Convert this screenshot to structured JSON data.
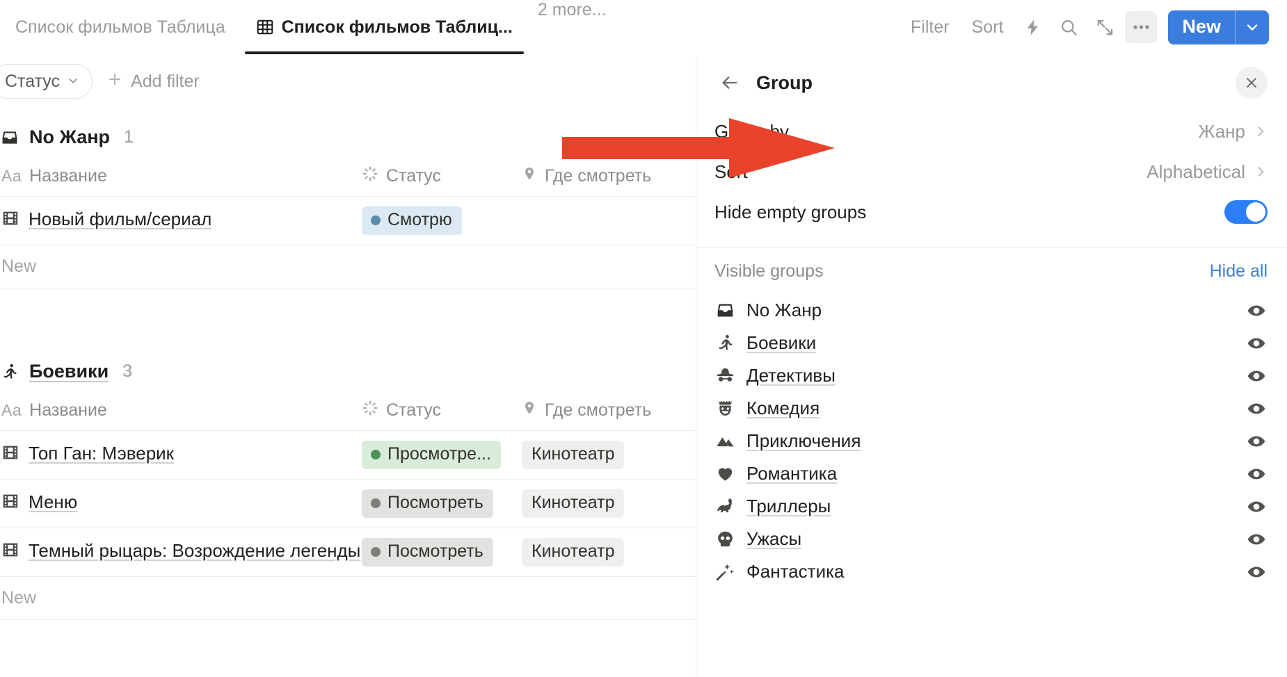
{
  "topbar": {
    "tabs": [
      {
        "label": "Список фильмов Таблица",
        "active": false,
        "has_icon": false
      },
      {
        "label": "Список фильмов Таблиц...",
        "active": true,
        "has_icon": true
      }
    ],
    "more_label": "2 more...",
    "filter_label": "Filter",
    "sort_label": "Sort",
    "icons": [
      "lightning-icon",
      "search-icon",
      "expand-icon",
      "more-options-icon"
    ],
    "new_label": "New",
    "accent_color": "#3b7ddd"
  },
  "filterbar": {
    "chip_label": "Статус",
    "add_filter_label": "Add filter"
  },
  "table": {
    "columns": {
      "name": "Название",
      "name_type": "Aa",
      "status": "Статус",
      "where": "Где смотреть"
    },
    "new_row_label": "New",
    "groups": [
      {
        "name": "No Жанр",
        "icon": "inbox-icon",
        "count": "1",
        "underlined": false,
        "rows": [
          {
            "title": "Новый фильм/сериал",
            "status": {
              "text": "Смотрю",
              "bg": "#dbeaf2",
              "dot": "#5b8cab"
            },
            "where": ""
          }
        ]
      },
      {
        "name": "Боевики",
        "icon": "running-icon",
        "count": "3",
        "underlined": true,
        "rows": [
          {
            "title": "Топ Ган: Мэверик",
            "status": {
              "text": "Просмотре...",
              "bg": "#d8ecd9",
              "dot": "#4f9255"
            },
            "where": "Кинотеатр"
          },
          {
            "title": "Меню",
            "status": {
              "text": "Посмотреть",
              "bg": "#e3e2e0",
              "dot": "#7e7d7a"
            },
            "where": "Кинотеатр"
          },
          {
            "title": "Темный рыцарь: Возрождение легенды",
            "status": {
              "text": "Посмотреть",
              "bg": "#e3e2e0",
              "dot": "#7e7d7a"
            },
            "where": "Кинотеатр"
          }
        ]
      }
    ]
  },
  "panel": {
    "title": "Group",
    "back_icon": "arrow-left-icon",
    "close_icon": "close-icon",
    "group_by_label": "Group by",
    "group_by_value": "Жанр",
    "sort_label": "Sort",
    "sort_value": "Alphabetical",
    "hide_empty_label": "Hide empty groups",
    "hide_empty_on": true,
    "visible_groups_label": "Visible groups",
    "hide_all_label": "Hide all",
    "toggle_color": "#2d7ff9",
    "link_color": "#3b7ddd",
    "groups": [
      {
        "label": "No Жанр",
        "icon": "inbox-icon",
        "underlined": false,
        "visible": true
      },
      {
        "label": "Боевики",
        "icon": "running-icon",
        "underlined": true,
        "visible": true
      },
      {
        "label": "Детективы",
        "icon": "detective-icon",
        "underlined": true,
        "visible": true
      },
      {
        "label": "Комедия",
        "icon": "comedy-mask-icon",
        "underlined": true,
        "visible": true
      },
      {
        "label": "Приключения",
        "icon": "mountains-icon",
        "underlined": true,
        "visible": true
      },
      {
        "label": "Романтика",
        "icon": "heart-icon",
        "underlined": true,
        "visible": true
      },
      {
        "label": "Триллеры",
        "icon": "rabbit-icon",
        "underlined": true,
        "visible": true
      },
      {
        "label": "Ужасы",
        "icon": "skull-icon",
        "underlined": true,
        "visible": true
      },
      {
        "label": "Фантастика",
        "icon": "sparkles-icon",
        "underlined": false,
        "visible": true
      }
    ]
  },
  "annotation": {
    "arrow_color": "#e8432a",
    "points_to": "Group by"
  }
}
